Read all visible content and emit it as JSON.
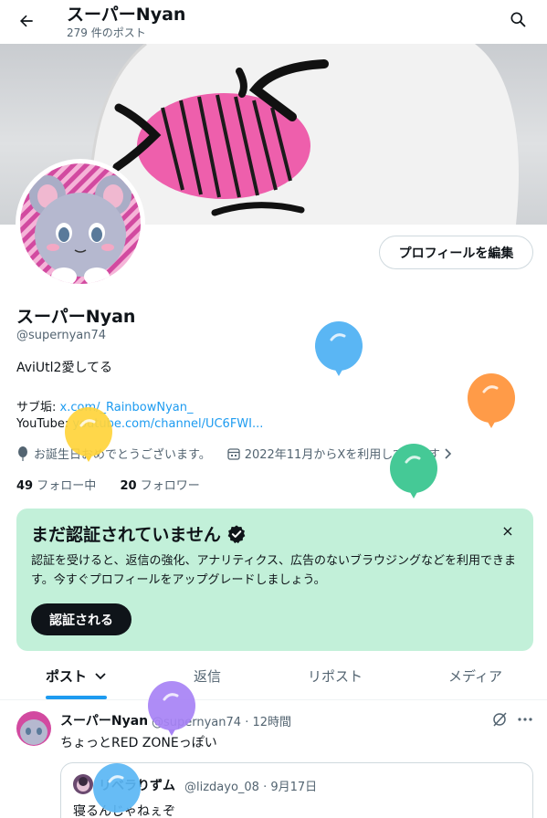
{
  "header": {
    "title": "スーパーNyan",
    "post_count": "279 件のポスト"
  },
  "profile": {
    "edit_label": "プロフィールを編集",
    "name": "スーパーNyan",
    "handle": "@supernyan74",
    "bio": "AviUtl2愛してる",
    "sub_label": "サブ垢: ",
    "sub_link": "x.com/_RainbowNyan_",
    "youtube_label": "YouTube: ",
    "youtube_link": "youtube.com/channel/UC6FWI...",
    "birthday": "お誕生日おめでとうございます。",
    "joined": "2022年11月からXを利用しています",
    "following_count": "49",
    "following_label": " フォロー中",
    "followers_count": "20",
    "followers_label": " フォロワー"
  },
  "verify": {
    "title": "まだ認証されていません",
    "description": "認証を受けると、返信の強化、アナリティクス、広告のないブラウジングなどを利用できます。今すぐプロフィールをアップグレードしましょう。",
    "button": "認証される",
    "close": "×"
  },
  "tabs": [
    {
      "label": "ポスト"
    },
    {
      "label": "返信"
    },
    {
      "label": "リポスト"
    },
    {
      "label": "メディア"
    }
  ],
  "post": {
    "name": "スーパーNyan",
    "handle_time": "@supernyan74 · 12時間",
    "text": "ちょっとRED ZONEっぽい",
    "quote": {
      "name": "リベラりずム",
      "handle_time": "@lizdayo_08 · 9月17日",
      "text": "寝るんじゃねぇぞ"
    }
  },
  "colors": {
    "accent": "#1d9bf0",
    "verify_bg": "#c2f0d9",
    "balloons": [
      "#5ab6f4",
      "#ffd43b",
      "#ff9b48",
      "#45c996",
      "#a782f5"
    ]
  }
}
